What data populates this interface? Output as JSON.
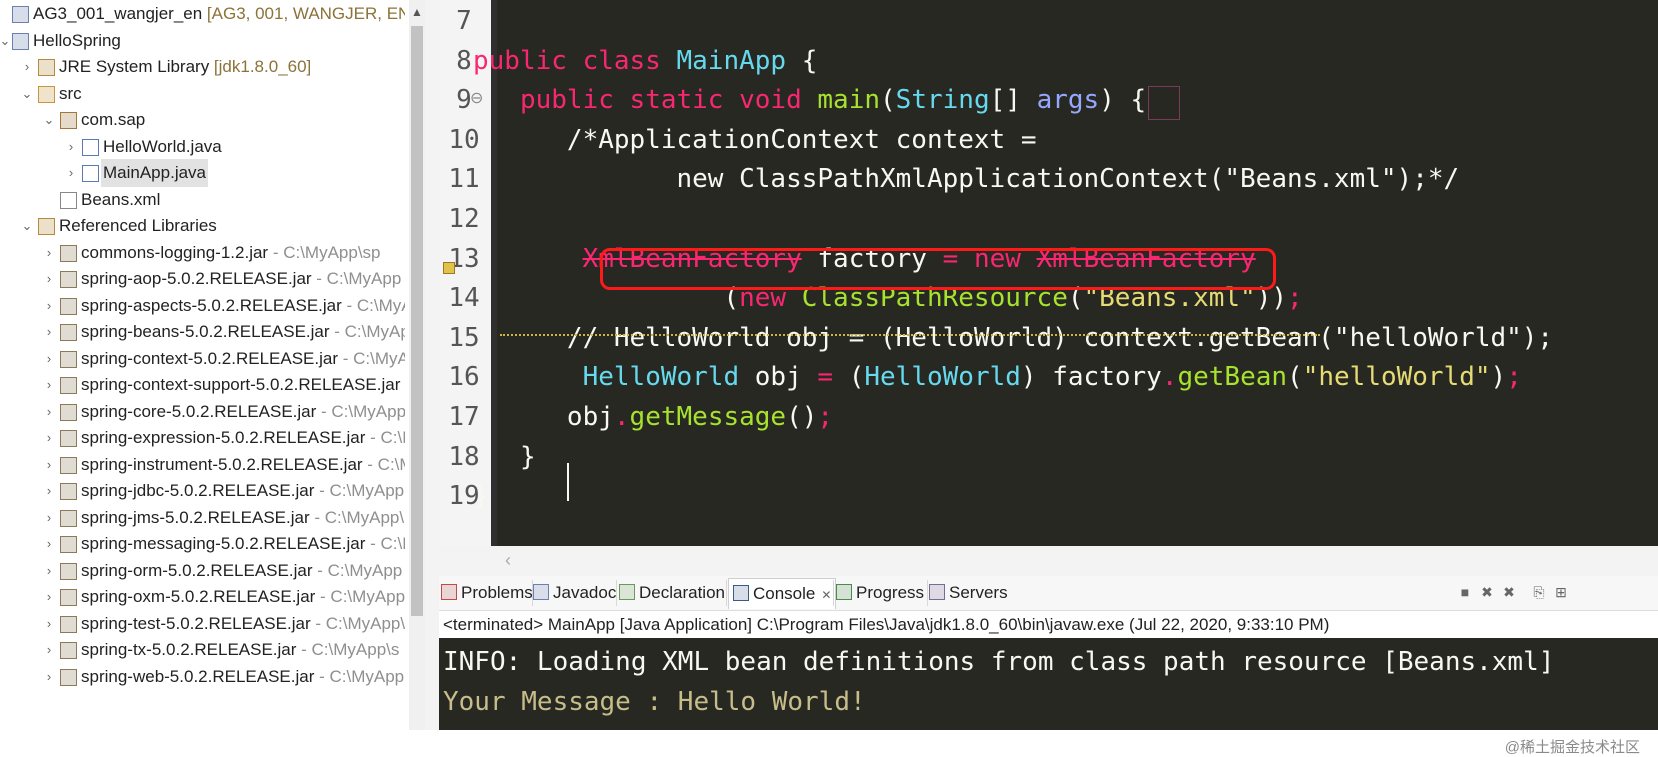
{
  "explorer": {
    "items": [
      {
        "label": "AG3_001_wangjer_en",
        "deco": " [AG3, 001, WANGJER, EN]",
        "indent": 0,
        "arrow": "none",
        "icon": "project"
      },
      {
        "label": "HelloSpring",
        "deco": "",
        "indent": 0,
        "arrow": "down",
        "icon": "project"
      },
      {
        "label": "JRE System Library",
        "deco": " [jdk1.8.0_60]",
        "indent": 1,
        "arrow": "right",
        "icon": "library"
      },
      {
        "label": "src",
        "deco": "",
        "indent": 1,
        "arrow": "down",
        "icon": "source-folder"
      },
      {
        "label": "com.sap",
        "deco": "",
        "indent": 2,
        "arrow": "down",
        "icon": "package"
      },
      {
        "label": "HelloWorld.java",
        "deco": "",
        "indent": 3,
        "arrow": "right",
        "icon": "java-file"
      },
      {
        "label": "MainApp.java",
        "deco": "",
        "indent": 3,
        "arrow": "right",
        "icon": "java-file",
        "selected": true
      },
      {
        "label": "Beans.xml",
        "deco": "",
        "indent": 2,
        "arrow": "none",
        "icon": "xml-file"
      },
      {
        "label": "Referenced Libraries",
        "deco": "",
        "indent": 1,
        "arrow": "down",
        "icon": "library"
      },
      {
        "label": "commons-logging-1.2.jar",
        "jdeco": " - C:\\MyApp\\sp",
        "indent": 2,
        "arrow": "right",
        "icon": "jar"
      },
      {
        "label": "spring-aop-5.0.2.RELEASE.jar",
        "jdeco": " - C:\\MyApp",
        "indent": 2,
        "arrow": "right",
        "icon": "jar"
      },
      {
        "label": "spring-aspects-5.0.2.RELEASE.jar",
        "jdeco": " - C:\\MyA",
        "indent": 2,
        "arrow": "right",
        "icon": "jar"
      },
      {
        "label": "spring-beans-5.0.2.RELEASE.jar",
        "jdeco": " - C:\\MyAp",
        "indent": 2,
        "arrow": "right",
        "icon": "jar"
      },
      {
        "label": "spring-context-5.0.2.RELEASE.jar",
        "jdeco": " - C:\\MyA",
        "indent": 2,
        "arrow": "right",
        "icon": "jar"
      },
      {
        "label": "spring-context-support-5.0.2.RELEASE.jar",
        "jdeco": "",
        "indent": 2,
        "arrow": "right",
        "icon": "jar"
      },
      {
        "label": "spring-core-5.0.2.RELEASE.jar",
        "jdeco": " - C:\\MyApp",
        "indent": 2,
        "arrow": "right",
        "icon": "jar"
      },
      {
        "label": "spring-expression-5.0.2.RELEASE.jar",
        "jdeco": " - C:\\M",
        "indent": 2,
        "arrow": "right",
        "icon": "jar"
      },
      {
        "label": "spring-instrument-5.0.2.RELEASE.jar",
        "jdeco": " - C:\\M",
        "indent": 2,
        "arrow": "right",
        "icon": "jar"
      },
      {
        "label": "spring-jdbc-5.0.2.RELEASE.jar",
        "jdeco": " - C:\\MyApp",
        "indent": 2,
        "arrow": "right",
        "icon": "jar"
      },
      {
        "label": "spring-jms-5.0.2.RELEASE.jar",
        "jdeco": " - C:\\MyApp\\",
        "indent": 2,
        "arrow": "right",
        "icon": "jar"
      },
      {
        "label": "spring-messaging-5.0.2.RELEASE.jar",
        "jdeco": " - C:\\M",
        "indent": 2,
        "arrow": "right",
        "icon": "jar"
      },
      {
        "label": "spring-orm-5.0.2.RELEASE.jar",
        "jdeco": " - C:\\MyApp",
        "indent": 2,
        "arrow": "right",
        "icon": "jar"
      },
      {
        "label": "spring-oxm-5.0.2.RELEASE.jar",
        "jdeco": " - C:\\MyApp",
        "indent": 2,
        "arrow": "right",
        "icon": "jar"
      },
      {
        "label": "spring-test-5.0.2.RELEASE.jar",
        "jdeco": " - C:\\MyApp\\",
        "indent": 2,
        "arrow": "right",
        "icon": "jar"
      },
      {
        "label": "spring-tx-5.0.2.RELEASE.jar",
        "jdeco": " - C:\\MyApp\\s",
        "indent": 2,
        "arrow": "right",
        "icon": "jar"
      },
      {
        "label": "spring-web-5.0.2.RELEASE.jar",
        "jdeco": " - C:\\MyApp",
        "indent": 2,
        "arrow": "right",
        "icon": "jar"
      }
    ]
  },
  "editor": {
    "lines": [
      {
        "num": "7",
        "tokens": []
      },
      {
        "num": "8",
        "tokens": [
          [
            "kw",
            "public class "
          ],
          [
            "ty",
            "MainApp"
          ],
          [
            "wht",
            " {"
          ]
        ]
      },
      {
        "num": "9",
        "tokens": [
          [
            "wht",
            "   "
          ],
          [
            "kw",
            "public static void "
          ],
          [
            "fn",
            "main"
          ],
          [
            "wht",
            "("
          ],
          [
            "ty",
            "String"
          ],
          [
            "wht",
            "[] "
          ],
          [
            "ar",
            "args"
          ],
          [
            "wht",
            ") {"
          ]
        ]
      },
      {
        "num": "10",
        "tokens": [
          [
            "cm",
            "      /*ApplicationContext context ="
          ]
        ]
      },
      {
        "num": "11",
        "tokens": [
          [
            "cm",
            "             new ClassPathXmlApplicationContext(\"Beans.xml\");*/"
          ]
        ]
      },
      {
        "num": "12",
        "tokens": []
      },
      {
        "num": "13",
        "tokens": [
          [
            "wht",
            "       "
          ],
          [
            "dep",
            "XmlBeanFactory"
          ],
          [
            "wht",
            " factory "
          ],
          [
            "kw",
            "="
          ],
          [
            "wht",
            " "
          ],
          [
            "kw",
            "new"
          ],
          [
            "wht",
            " "
          ],
          [
            "dep",
            "XmlBeanFactory"
          ]
        ]
      },
      {
        "num": "14",
        "tokens": [
          [
            "wht",
            "                ("
          ],
          [
            "kw",
            "new"
          ],
          [
            "wht",
            " "
          ],
          [
            "fn",
            "ClassPathResource"
          ],
          [
            "wht",
            "("
          ],
          [
            "str",
            "\"Beans.xml\""
          ],
          [
            "wht",
            "))"
          ],
          [
            "kw",
            ";"
          ]
        ]
      },
      {
        "num": "15",
        "tokens": [
          [
            "cm",
            "      // HelloWorld obj = (HelloWorld) context.getBean(\"helloWorld\");"
          ]
        ]
      },
      {
        "num": "16",
        "tokens": [
          [
            "wht",
            "       "
          ],
          [
            "ty",
            "HelloWorld"
          ],
          [
            "wht",
            " obj "
          ],
          [
            "kw",
            "="
          ],
          [
            "wht",
            " ("
          ],
          [
            "ty",
            "HelloWorld"
          ],
          [
            "wht",
            ") factory"
          ],
          [
            "kw",
            "."
          ],
          [
            "fn",
            "getBean"
          ],
          [
            "wht",
            "("
          ],
          [
            "str",
            "\"helloWorld\""
          ],
          [
            "wht",
            ")"
          ],
          [
            "kw",
            ";"
          ]
        ]
      },
      {
        "num": "17",
        "tokens": [
          [
            "wht",
            "      obj"
          ],
          [
            "kw",
            "."
          ],
          [
            "fn",
            "getMessage"
          ],
          [
            "wht",
            "()"
          ],
          [
            "kw",
            ";"
          ]
        ]
      },
      {
        "num": "18",
        "tokens": [
          [
            "wht",
            "   }"
          ]
        ]
      },
      {
        "num": "19",
        "tokens": [
          [
            "wht",
            "}"
          ]
        ]
      }
    ]
  },
  "panel": {
    "tabs": [
      {
        "label": "Problems",
        "icon": "problems-icon"
      },
      {
        "label": "Javadoc",
        "icon": "javadoc-icon"
      },
      {
        "label": "Declaration",
        "icon": "declaration-icon"
      },
      {
        "label": "Console",
        "icon": "console-icon",
        "active": true,
        "close": "✕"
      },
      {
        "label": "Progress",
        "icon": "progress-icon"
      },
      {
        "label": "Servers",
        "icon": "servers-icon"
      }
    ],
    "status": "<terminated> MainApp [Java Application] C:\\Program Files\\Java\\jdk1.8.0_60\\bin\\javaw.exe (Jul 22, 2020, 9:33:10 PM)",
    "output": [
      {
        "text": "INFO: Loading XML bean definitions from class path resource [Beans.xml]",
        "color": "#f8f8f2"
      },
      {
        "text": "Your Message : Hello World!",
        "color": "#c7bd8a"
      }
    ],
    "watermark": "@稀土掘金技术社区"
  },
  "colors": {
    "editor_bg": "#272822",
    "keyword": "#f92672",
    "type": "#66d9ef",
    "function": "#a6e22e",
    "string": "#e6db74",
    "highlight_box": "#ff1a1a"
  }
}
